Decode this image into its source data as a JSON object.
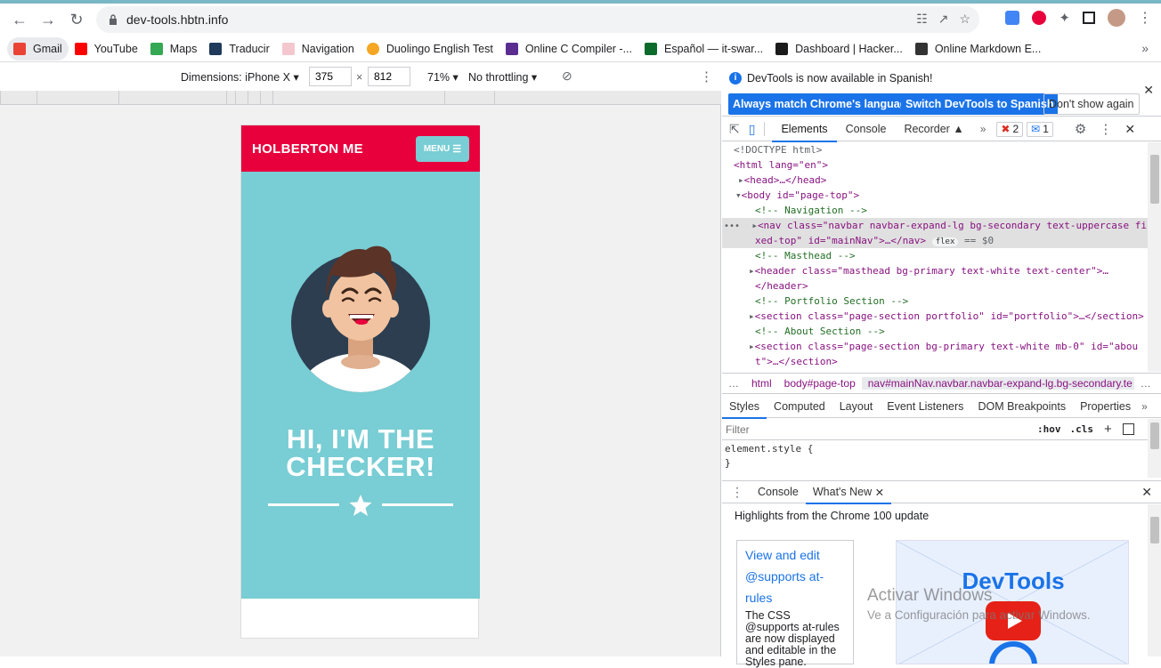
{
  "browser": {
    "url": "dev-tools.hbtn.info",
    "bookmarks": [
      {
        "label": "Gmail",
        "color": "#ea4335"
      },
      {
        "label": "YouTube",
        "color": "#ff0000"
      },
      {
        "label": "Maps",
        "color": "#34a853"
      },
      {
        "label": "Traducir",
        "color": "#4285f4"
      },
      {
        "label": "Navigation",
        "color": "#e8003d"
      },
      {
        "label": "Duolingo English Test",
        "color": "#f5a623"
      },
      {
        "label": "Online C Compiler -...",
        "color": "#5c2d91"
      },
      {
        "label": "Español — it-swar...",
        "color": "#0c6b2a"
      },
      {
        "label": "Dashboard | Hacker...",
        "color": "#1a1a1a"
      },
      {
        "label": "Online Markdown E...",
        "color": "#333333"
      }
    ]
  },
  "device_toolbar": {
    "dimensions_label": "Dimensions: iPhone X",
    "width": "375",
    "times": "×",
    "height": "812",
    "zoom": "71%",
    "throttling": "No throttling"
  },
  "phone": {
    "brand": "HOLBERTON ME",
    "menu": "MENU",
    "title_line1": "HI, I'M THE",
    "title_line2": "CHECKER!",
    "colors": {
      "nav": "#e8003d",
      "masthead": "#79cdd4"
    }
  },
  "devtools": {
    "info_text": "DevTools is now available in Spanish!",
    "btn_match": "Always match Chrome's language",
    "btn_switch": "Switch DevTools to Spanish",
    "btn_dont": "Don't show again",
    "tabs": [
      "Elements",
      "Console",
      "Recorder"
    ],
    "errors": "2",
    "messages": "1",
    "dom": {
      "doctype": "<!DOCTYPE html>",
      "html_open": "<html lang=\"en\">",
      "head": "<head>…</head>",
      "body_open": "<body id=\"page-top\">",
      "c_nav": "<!-- Navigation -->",
      "nav_line1": "<nav class=\"navbar navbar-expand-lg bg-secondary text-uppercase fi",
      "nav_line2": "xed-top\" id=\"mainNav\">…</nav>",
      "flex_badge": "flex",
      "eq0": "== $0",
      "c_mast": "<!-- Masthead -->",
      "header_line": "<header class=\"masthead bg-primary text-white text-center\">…",
      "header_close": "</header>",
      "c_port": "<!-- Portfolio Section -->",
      "section_port": "<section class=\"page-section portfolio\" id=\"portfolio\">…</section>",
      "c_about": "<!-- About Section -->",
      "section_about1": "<section class=\"page-section bg-primary text-white mb-0\" id=\"abou",
      "section_about2": "t\">…</section>"
    },
    "crumbs": [
      "html",
      "body#page-top",
      "nav#mainNav.navbar.navbar-expand-lg.bg-secondary.te"
    ],
    "subtabs": [
      "Styles",
      "Computed",
      "Layout",
      "Event Listeners",
      "DOM Breakpoints",
      "Properties"
    ],
    "filter_placeholder": "Filter",
    "hov": ":hov",
    "cls": ".cls",
    "element_style": "element.style {",
    "close_brace": "}",
    "drawer_tabs": [
      "Console",
      "What's New"
    ],
    "highlights": "Highlights from the Chrome 100 update",
    "card_link1": "View and edit",
    "card_link2": "@supports at-",
    "card_link3": "rules",
    "card_text": "The CSS @supports at-rules are now displayed and editable in the Styles pane.",
    "video_title": "DevTools",
    "watermark1": "Activar Windows",
    "watermark2": "Ve a Configuración para activar Windows."
  }
}
